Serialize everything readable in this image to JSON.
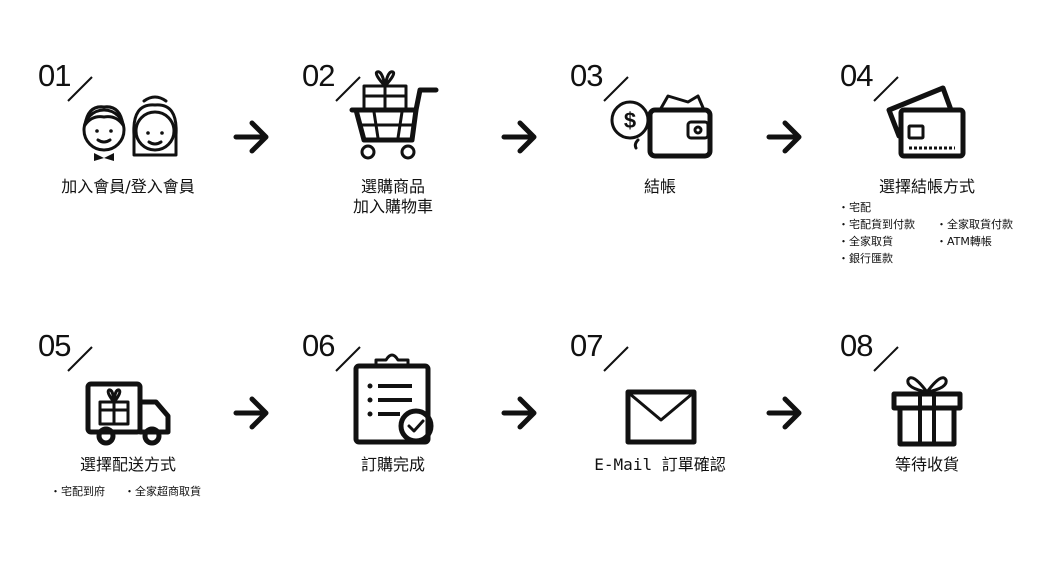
{
  "steps": [
    {
      "num": "01",
      "label": "加入會員/登入會員",
      "icon": "member-couple-icon"
    },
    {
      "num": "02",
      "label_lines": [
        "選購商品",
        "加入購物車"
      ],
      "icon": "shopping-cart-icon"
    },
    {
      "num": "03",
      "label": "結帳",
      "icon": "wallet-icon"
    },
    {
      "num": "04",
      "label": "選擇結帳方式",
      "icon": "credit-card-icon",
      "options": [
        "・宅配",
        "・宅配貨到付款",
        "・全家取貨",
        "・銀行匯款",
        "・全家取貨付款",
        "・ATM轉帳"
      ]
    },
    {
      "num": "05",
      "label": "選擇配送方式",
      "icon": "delivery-truck-icon",
      "options": [
        "・宅配到府",
        "・全家超商取貨"
      ]
    },
    {
      "num": "06",
      "label": "訂購完成",
      "icon": "clipboard-check-icon"
    },
    {
      "num": "07",
      "label": "E-Mail 訂單確認",
      "icon": "envelope-icon"
    },
    {
      "num": "08",
      "label": "等待收貨",
      "icon": "gift-box-icon"
    }
  ],
  "arrow_icon": "arrow-right-icon"
}
